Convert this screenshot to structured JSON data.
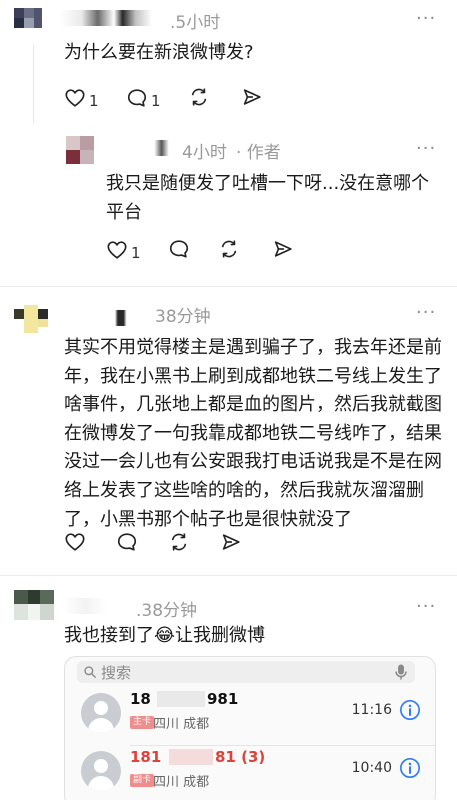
{
  "comments": [
    {
      "time": ".5小时",
      "text": "为什么要在新浪微博发?",
      "like_count": "1",
      "reply_count": "1",
      "more": "···"
    },
    {
      "time": "4小时",
      "author_tag": "· 作者",
      "text": "我只是随便发了吐槽一下呀...没在意哪个\n平台",
      "like_count": "1",
      "more": "···"
    },
    {
      "time": "38分钟",
      "text": "其实不用觉得楼主是遇到骗子了，我去年还是前\n年，我在小黑书上刷到成都地铁二号线上发生了\n啥事件，几张地上都是血的图片，然后我就截图\n在微博发了一句我靠成都地铁二号线咋了，结果\n没过一会儿也有公安跟我打电话说我是不是在网\n络上发表了这些啥的啥的，然后我就灰溜溜删\n了，小黑书那个帖子也是很快就没了",
      "more": "···"
    },
    {
      "time": ".38分钟",
      "text_before": "我也接到了",
      "emoji": "😂",
      "text_after": "让我删微博",
      "more": "···"
    }
  ],
  "call_log": {
    "search_placeholder": "搜索",
    "calls": [
      {
        "number_start": "18",
        "number_end": "981",
        "sim": "主卡",
        "location": "四川 成都",
        "time": "11:16",
        "missed": false
      },
      {
        "number_start": "181",
        "number_end": "81 (3)",
        "sim": "副卡",
        "location": "四川 成都",
        "time": "10:40",
        "missed": true
      }
    ]
  },
  "colors": {
    "missed_call": "#e0423a",
    "info_blue": "#2f7df6",
    "meta_gray": "#9a9a9a"
  },
  "icons": [
    "heart-icon",
    "comment-icon",
    "repost-icon",
    "share-icon",
    "search-icon",
    "microphone-icon",
    "info-icon",
    "more-icon"
  ]
}
